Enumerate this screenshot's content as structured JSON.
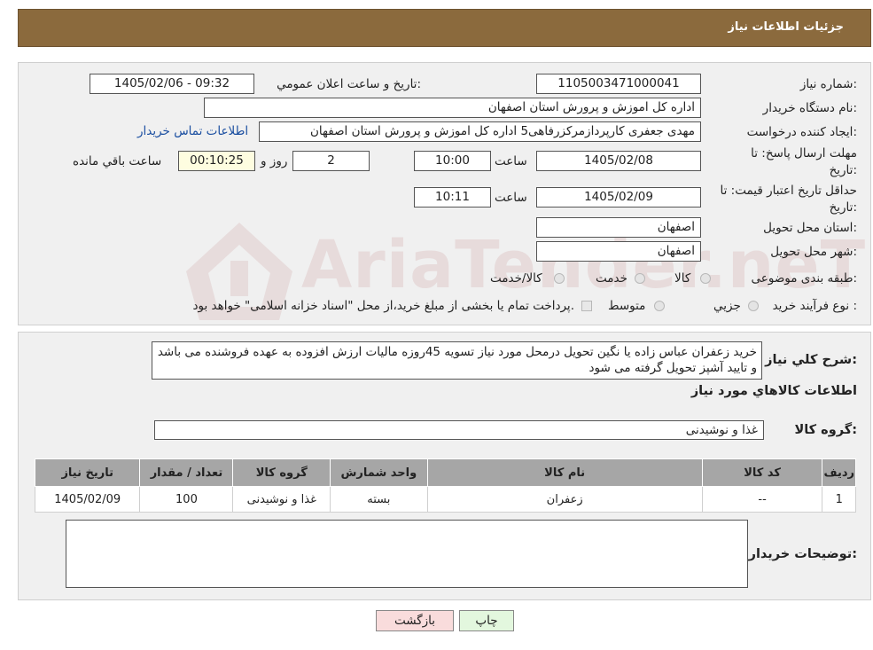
{
  "header": {
    "title": "جزئیات اطلاعات نیاز"
  },
  "fields": {
    "need_number_label": "شماره نیاز:",
    "need_number": "1105003471000041",
    "announce_label": "تاریخ و ساعت اعلان عمومي:",
    "announce_value": "1405/02/06 - 09:32",
    "buyer_org_label": "نام دستگاه خريدار:",
    "buyer_org": "اداره کل اموزش و پرورش استان اصفهان",
    "creator_label": "ايجاد کننده درخواست:",
    "creator": "مهدی جعفری کارپردازمرکزرفاهی5 اداره کل اموزش و پرورش استان اصفهان",
    "contact_link": "اطلاعات تماس خريدار",
    "deadline_label_1": "مهلت ارسال پاسخ: تا",
    "deadline_label_2": "تاريخ:",
    "deadline_date": "1405/02/08",
    "time_label": "ساعت",
    "deadline_time": "10:00",
    "days_value": "2",
    "days_label": "روز و",
    "remaining_value": "00:10:25",
    "remaining_label": "ساعت باقي مانده",
    "validity_label_1": "حداقل تاريخ اعتبار قيمت: تا",
    "validity_label_2": "تاريخ:",
    "validity_date": "1405/02/09",
    "validity_time_label": "ساعت",
    "validity_time": "10:11",
    "province_label": "استان محل تحويل:",
    "province": "اصفهان",
    "city_label": "شهر محل تحويل:",
    "city": "اصفهان",
    "category_label": "طبقه بندی موضوعی:",
    "category_options": [
      "کالا",
      "خدمت",
      "کالا/خدمت"
    ],
    "process_label": "نوع فرآيند خريد :",
    "process_options": [
      "جزيي",
      "متوسط"
    ],
    "process_note": "پرداخت تمام يا بخشی از مبلغ خريد،از محل \"اسناد خزانه اسلامی\" خواهد بود."
  },
  "watermark": "AriaTender.neT",
  "description": {
    "label": "شرح کلي نياز:",
    "text": "خريد زعفران عباس زاده يا نگين تحويل درمحل مورد نياز تسويه 45روزه ماليات ارزش افزوده به عهده فروشنده می باشد و تاييد آشپز تحويل گرفته می شود"
  },
  "goods_section": {
    "title": "اطلاعات کالاهاي مورد نياز",
    "group_label": "گروه کالا:",
    "group_value": "غذا و نوشيدنی"
  },
  "table": {
    "headers": [
      "رديف",
      "کد کالا",
      "نام کالا",
      "واحد شمارش",
      "گروه کالا",
      "تعداد / مقدار",
      "تاريخ نياز"
    ],
    "rows": [
      [
        "1",
        "--",
        "زعفران",
        "بسته",
        "غذا و نوشيدنی",
        "100",
        "1405/02/09"
      ]
    ]
  },
  "buyer_notes": {
    "label": "توضيحات خريدار:",
    "value": ""
  },
  "buttons": {
    "print": "چاپ",
    "back": "بازگشت"
  },
  "colors": {
    "header_bg": "#8b6a3d",
    "panel_bg": "#f0f0f0",
    "table_header_bg": "#a6a6a6",
    "back_button_bg": "#f9dcdc",
    "print_button_bg": "#e3f7de"
  }
}
